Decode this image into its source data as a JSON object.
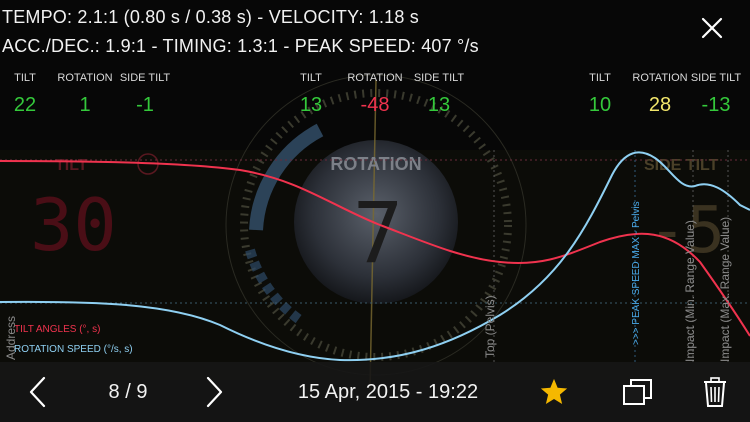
{
  "header": {
    "line1": "TEMPO: 2.1:1 (0.80 s / 0.38 s) - VELOCITY: 1.18 s",
    "line2": "ACC./DEC.: 1.9:1 - TIMING: 1.3:1 - PEAK SPEED: 407 °/s"
  },
  "icons": {
    "close": "close-icon",
    "prev": "chevron-left-icon",
    "next": "chevron-right-icon",
    "favorite": "star-icon",
    "copy": "copy-icon",
    "trash": "trash-icon"
  },
  "groups": [
    {
      "items": [
        {
          "label": "TILT",
          "value": "22",
          "color": "#34c93b"
        },
        {
          "label": "ROTATION",
          "value": "1",
          "color": "#34c93b"
        },
        {
          "label": "SIDE TILT",
          "value": "-1",
          "color": "#34c93b"
        }
      ]
    },
    {
      "items": [
        {
          "label": "TILT",
          "value": "13",
          "color": "#34c93b"
        },
        {
          "label": "ROTATION",
          "value": "-48",
          "color": "#f0334e"
        },
        {
          "label": "SIDE TILT",
          "value": "13",
          "color": "#34c93b"
        }
      ]
    },
    {
      "items": [
        {
          "label": "TILT",
          "value": "10",
          "color": "#34c93b"
        },
        {
          "label": "ROTATION",
          "value": "28",
          "color": "#f2e66b"
        },
        {
          "label": "SIDE TILT",
          "value": "-13",
          "color": "#34c93b"
        }
      ]
    }
  ],
  "background": {
    "tilt_label": "TILT",
    "tilt_value": "30",
    "rotation_label": "ROTATION",
    "rotation_value": "7",
    "sidetilt_label": "SIDE TILT",
    "sidetilt_value": "-5"
  },
  "chart": {
    "legend_tilt": "TILT ANGLES (°, s)",
    "legend_rotation": "ROTATION SPEED (°/s, s)",
    "marker_address": "Address",
    "marker_top": "Top (Pelvis)",
    "marker_peak": ">>> PEAK SPEED MAX - Pelvis",
    "marker_impact_min": "Impact (Min. Range Value)",
    "marker_impact_max": "Impact (Max. Range Value)",
    "tilt_color": "#f0334e",
    "rotation_color": "#8fd0f2"
  },
  "toolbar": {
    "page": "8 / 9",
    "date": "15 Apr, 2015 - 19:22",
    "star_color": "#f5b800"
  }
}
